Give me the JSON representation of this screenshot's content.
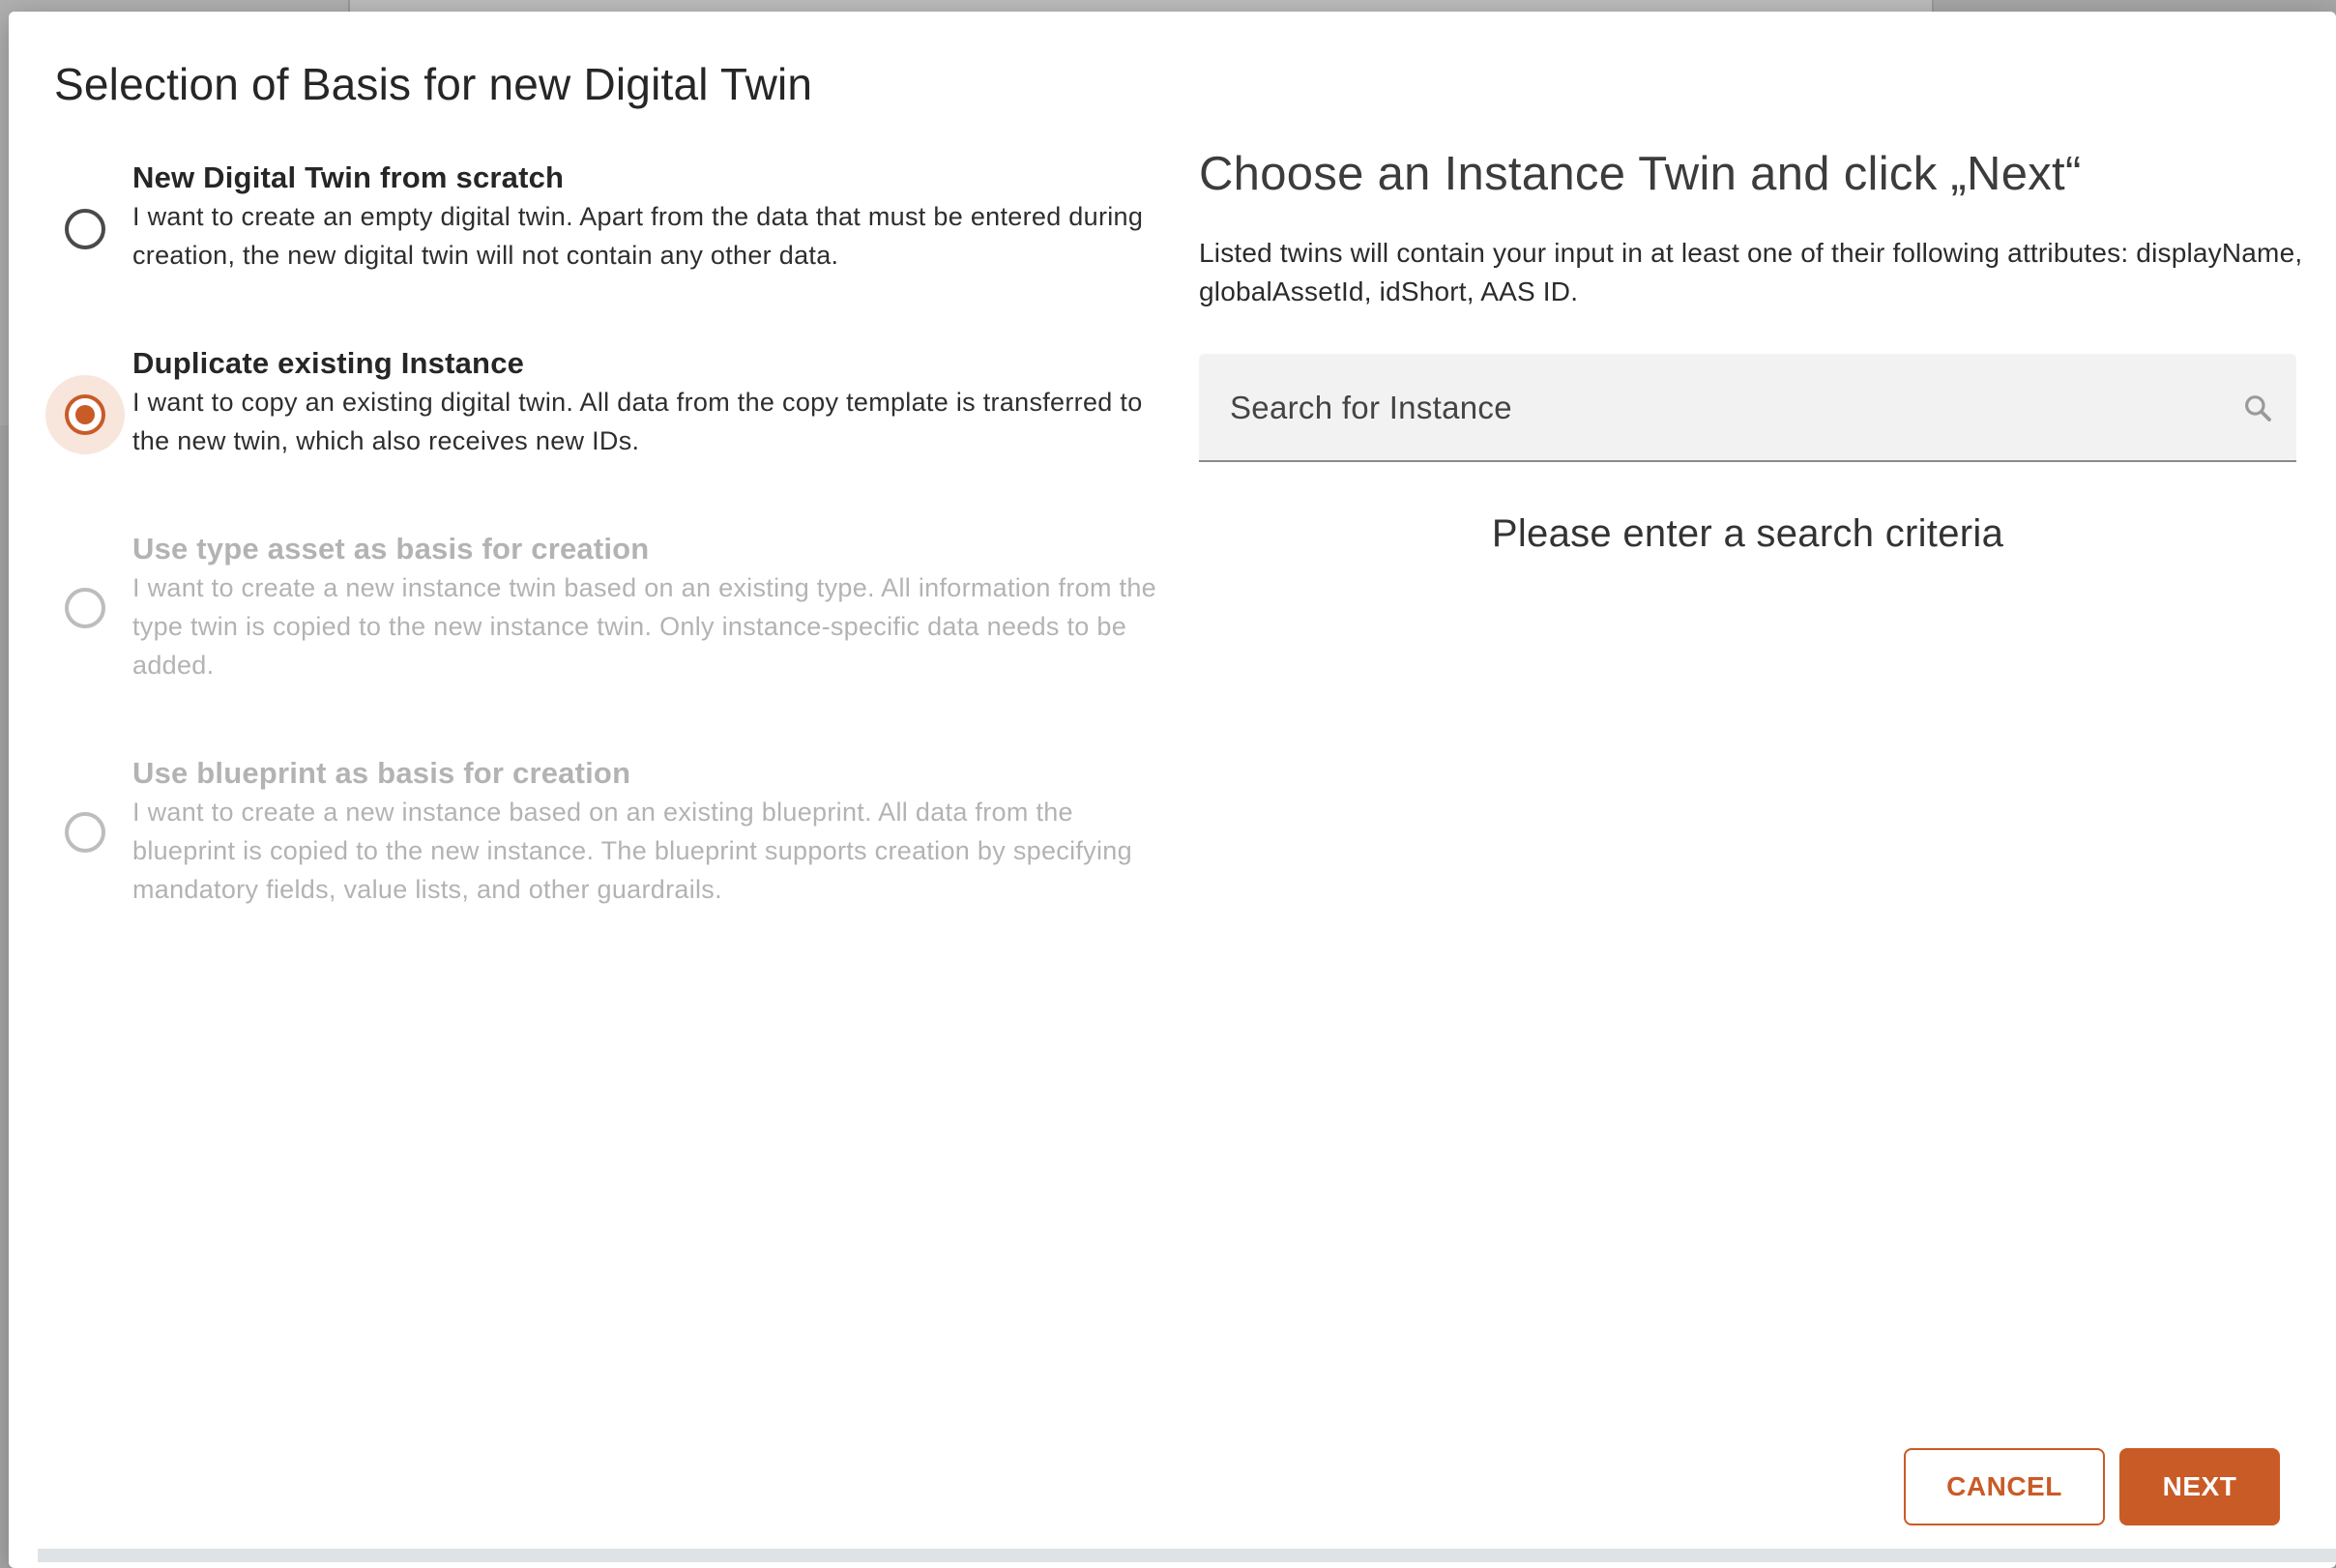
{
  "dialog": {
    "title": "Selection of Basis for new Digital Twin"
  },
  "options": [
    {
      "title": "New Digital Twin from scratch",
      "description": "I want to create an empty digital twin. Apart from the data that must be entered during creation, the new digital twin will not contain any other data.",
      "selected": false,
      "disabled": false
    },
    {
      "title": "Duplicate existing Instance",
      "description": "I want to copy an existing digital twin. All data from the copy template is transferred to the new twin, which also receives new IDs.",
      "selected": true,
      "disabled": false
    },
    {
      "title": "Use type asset as basis for creation",
      "description": "I want to create a new instance twin based on an existing type. All information from the type twin is copied to the new instance twin. Only instance-specific data needs to be added.",
      "selected": false,
      "disabled": true
    },
    {
      "title": "Use blueprint as basis for creation",
      "description": "I want to create a new instance based on an existing blueprint. All data from the blueprint is copied to the new instance. The blueprint supports creation by specifying mandatory fields, value lists, and other guardrails.",
      "selected": false,
      "disabled": true
    }
  ],
  "right_panel": {
    "heading": "Choose an Instance Twin and click „Next“",
    "description": "Listed twins will contain your input in at least one of their following attributes: displayName, globalAssetId, idShort, AAS ID.",
    "search": {
      "placeholder": "Search for Instance",
      "value": "",
      "icon": "search-icon"
    },
    "empty_message": "Please enter a search criteria"
  },
  "actions": {
    "cancel_label": "CANCEL",
    "next_label": "NEXT"
  },
  "colors": {
    "accent": "#c95b27",
    "accent_light": "#f8e6dc",
    "disabled_text": "#b3b3b3"
  }
}
